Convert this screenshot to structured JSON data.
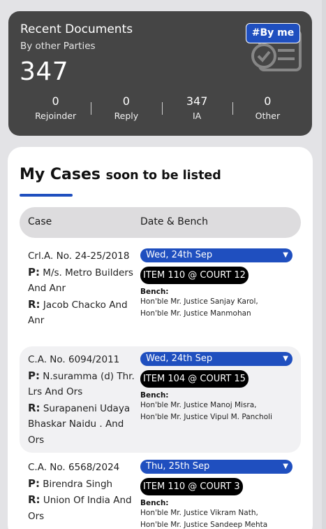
{
  "recent": {
    "title": "Recent Documents",
    "subtitle": "By other Parties",
    "count": "347",
    "byme_label": "#By me",
    "stats": [
      {
        "value": "0",
        "label": "Rejoinder"
      },
      {
        "value": "0",
        "label": "Reply"
      },
      {
        "value": "347",
        "label": "IA"
      },
      {
        "value": "0",
        "label": "Other"
      }
    ]
  },
  "cases": {
    "title_main": "My Cases",
    "title_sub": "soon to be listed",
    "col_case": "Case",
    "col_date": "Date & Bench",
    "rows": [
      {
        "case_no": "Crl.A. No. 24-25/2018",
        "p_label": "P:",
        "petitioner": "M/s. Metro Builders And Anr",
        "r_label": "R:",
        "respondent": "Jacob Chacko And Anr",
        "date": "Wed, 24th Sep",
        "item": "ITEM 110 @ COURT 12",
        "bench_label": "Bench:",
        "judges": [
          "Hon'ble Mr. Justice Sanjay Karol,",
          "Hon'ble Mr. Justice Manmohan"
        ]
      },
      {
        "case_no": "C.A. No. 6094/2011",
        "p_label": "P:",
        "petitioner": "N.suramma (d) Thr. Lrs And Ors",
        "r_label": "R:",
        "respondent": "Surapaneni Udaya Bhaskar Naidu . And Ors",
        "date": "Wed, 24th Sep",
        "item": "ITEM 104 @ COURT 15",
        "bench_label": "Bench:",
        "judges": [
          "Hon'ble Mr. Justice Manoj Misra,",
          "Hon'ble Mr. Justice Vipul M. Pancholi"
        ]
      },
      {
        "case_no": "C.A. No. 6568/2024",
        "p_label": "P:",
        "petitioner": "Birendra Singh",
        "r_label": "R:",
        "respondent": "Union Of India And Ors",
        "date": "Thu, 25th Sep",
        "item": "ITEM 110 @ COURT 3",
        "bench_label": "Bench:",
        "judges": [
          "Hon'ble Mr. Justice Vikram Nath,",
          "Hon'ble Mr. Justice Sandeep Mehta"
        ]
      }
    ]
  },
  "colors": {
    "accent": "#1f4fbf",
    "card_dark": "#454545",
    "page_bg": "#e3e3e6"
  },
  "icons": {
    "date_dropdown": "chevron-down-icon",
    "recent_bg": "document-check-icon"
  }
}
